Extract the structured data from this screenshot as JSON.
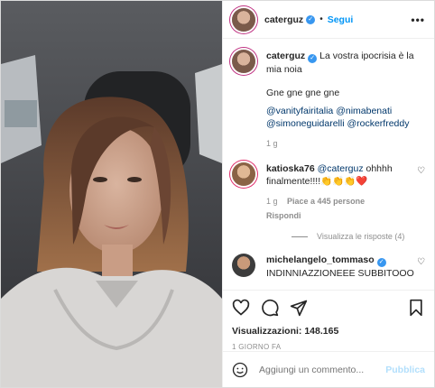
{
  "post": {
    "author": "caterguz",
    "follow_label": "Segui",
    "more_label": "•••"
  },
  "caption": {
    "username": "caterguz",
    "text": "La vostra ipocrisia è la mia noia",
    "line2": "Gne gne gne gne",
    "tags": [
      "@vanityfairitalia",
      "@nimabenati",
      "@simoneguidarelli",
      "@rockerfreddy"
    ],
    "age": "1 g"
  },
  "comments": [
    {
      "username": "katioska76",
      "mention": "@caterguz",
      "text": "ohhhh finalmente!!!!👏👏👏❤️",
      "age": "1 g",
      "likes": "Piace a 445 persone",
      "reply": "Rispondi",
      "view_replies": "Visualizza le risposte (4)"
    },
    {
      "username": "michelangelo_tommaso",
      "text": "INDINNIAZZIONEEE SUBBITOOO"
    }
  ],
  "stats": {
    "views": "Visualizzazioni: 148.165",
    "date": "1 GIORNO FA"
  },
  "add_comment": {
    "placeholder": "Aggiungi un commento...",
    "publish_label": "Pubblica"
  },
  "colors": {
    "link": "#0095f6",
    "verified": "#3897f0",
    "tag": "#00376b",
    "muted": "#8e8e8e"
  }
}
